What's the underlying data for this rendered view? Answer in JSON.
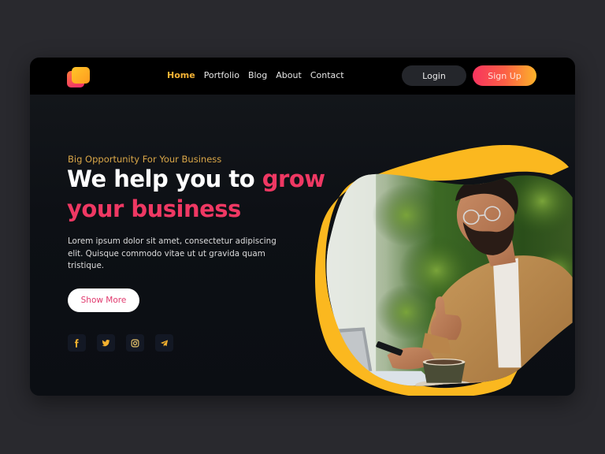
{
  "header": {
    "logo": "app-logo",
    "nav": [
      {
        "label": "Home",
        "active": true
      },
      {
        "label": "Portfolio",
        "active": false
      },
      {
        "label": "Blog",
        "active": false
      },
      {
        "label": "About",
        "active": false
      },
      {
        "label": "Contact",
        "active": false
      }
    ],
    "login_label": "Login",
    "signup_label": "Sign Up"
  },
  "hero": {
    "eyebrow": "Big Opportunity For Your Business",
    "headline_white": "We help you to ",
    "headline_accent_1": "grow",
    "headline_accent_2": "your business",
    "description": "Lorem ipsum dolor sit amet, consectetur adipiscing elit. Quisque commodo vitae ut ut gravida quam tristique.",
    "cta_label": "Show More",
    "image_alt": "Smiling bearded man with glasses in tan jacket giving a thumbs up while holding a phone, with a laptop and coffee cup in front of a green plant wall",
    "socials": [
      {
        "name": "facebook-icon"
      },
      {
        "name": "twitter-icon"
      },
      {
        "name": "instagram-icon"
      },
      {
        "name": "telegram-icon"
      }
    ]
  },
  "colors": {
    "accent_pink": "#ef3863",
    "accent_yellow": "#fdb42a",
    "nav_active": "#f5b335",
    "page_bg": "#29292e",
    "card_bg": "#0d1015"
  }
}
